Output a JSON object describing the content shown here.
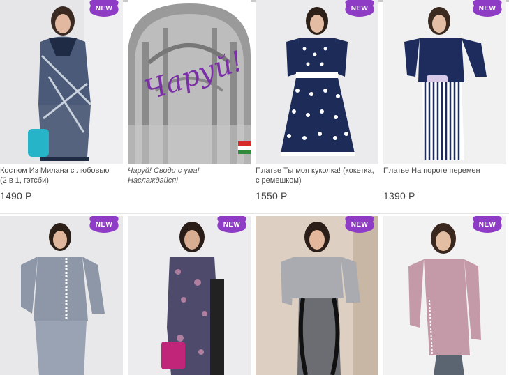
{
  "badge_label": "NEW",
  "promo": {
    "script_text": "Чаруй!",
    "caption": "Чаруй! Своди с ума! Наслаждайся!",
    "flag": "hungary-flag"
  },
  "products_row1": [
    {
      "title": "Костюм Из Милана с любовью (2 в 1, гэтсби)",
      "price": "1490 Р"
    },
    {
      "title": "Платье Ты моя куколка! (кокетка, с ремешком)",
      "price": "1550 Р"
    },
    {
      "title": "Платье На пороге перемен",
      "price": "1390 Р"
    }
  ],
  "products_row2": [
    {
      "title": "",
      "price": ""
    },
    {
      "title": "",
      "price": ""
    },
    {
      "title": "",
      "price": ""
    },
    {
      "title": "",
      "price": ""
    }
  ],
  "colors": {
    "badge": "#8e3bc6",
    "promo_script": "#7b2fa6"
  }
}
